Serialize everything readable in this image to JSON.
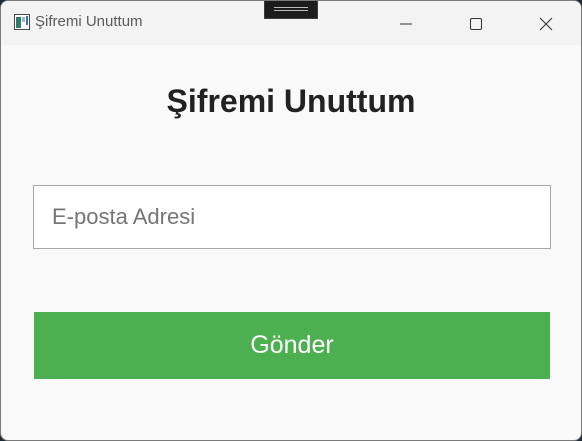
{
  "window": {
    "title": "Şifremi Unuttum",
    "controls": [
      "minimize",
      "maximize",
      "close"
    ]
  },
  "form": {
    "heading": "Şifremi Unuttum",
    "email_placeholder": "E-posta Adresi",
    "email_value": "",
    "submit_label": "Gönder"
  },
  "colors": {
    "accent": "#4caf50",
    "window_bg": "#f9f9f9",
    "titlebar_bg": "#f3f3f3",
    "heading_text": "#222222"
  },
  "icons": {
    "app": "app-icon",
    "minimize": "minimize-icon",
    "maximize": "maximize-icon",
    "close": "close-icon"
  }
}
